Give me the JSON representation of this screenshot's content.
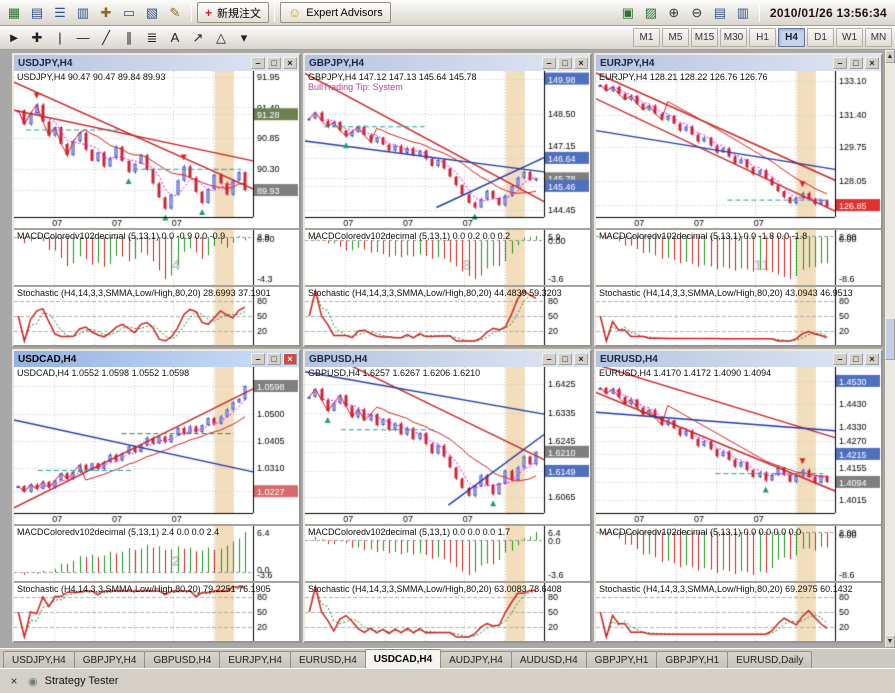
{
  "toolbar": {
    "main_icons": [
      {
        "name": "new-chart",
        "glyph": "▦",
        "color": "#2f6f2f"
      },
      {
        "name": "profiles",
        "glyph": "▤",
        "color": "#35508a"
      },
      {
        "name": "market-watch",
        "glyph": "☰",
        "color": "#35508a"
      },
      {
        "name": "data-window",
        "glyph": "▥",
        "color": "#35508a"
      },
      {
        "name": "navigator",
        "glyph": "✚",
        "color": "#8a6a20"
      },
      {
        "name": "terminal",
        "glyph": "▭",
        "color": "#35508a"
      },
      {
        "name": "strategy-tester-toolbar",
        "glyph": "▧",
        "color": "#35508a"
      },
      {
        "name": "metaeditor",
        "glyph": "✎",
        "color": "#8a6a20"
      }
    ],
    "new_order_glyph": "+",
    "new_order_label": "新規注文",
    "expert_glyph": "☺",
    "expert_advisors_label": "Expert Advisors",
    "window_icons": [
      {
        "name": "tile-windows",
        "glyph": "▣",
        "color": "#2f6f2f"
      },
      {
        "name": "cascade-windows",
        "glyph": "▨",
        "color": "#2f6f2f"
      },
      {
        "name": "zoom-in",
        "glyph": "⊕",
        "color": "#333333"
      },
      {
        "name": "zoom-out",
        "glyph": "⊖",
        "color": "#333333"
      },
      {
        "name": "tile-horizontally",
        "glyph": "▤",
        "color": "#35508a"
      },
      {
        "name": "tile-vertically",
        "glyph": "▥",
        "color": "#35508a"
      }
    ],
    "draw_icons": [
      {
        "name": "cursor",
        "glyph": "►",
        "color": "#222222"
      },
      {
        "name": "crosshair",
        "glyph": "✚",
        "color": "#222222"
      },
      {
        "name": "vertical-line",
        "glyph": "|",
        "color": "#222222"
      },
      {
        "name": "horizontal-line",
        "glyph": "—",
        "color": "#222222"
      },
      {
        "name": "trendline",
        "glyph": "╱",
        "color": "#222222"
      },
      {
        "name": "equidistant-channel",
        "glyph": "∥",
        "color": "#222222"
      },
      {
        "name": "fibonacci-retracement",
        "glyph": "≣",
        "color": "#222222"
      },
      {
        "name": "text",
        "glyph": "A",
        "color": "#222222"
      },
      {
        "name": "arrows",
        "glyph": "↗",
        "color": "#222222"
      },
      {
        "name": "shapes",
        "glyph": "△",
        "color": "#222222"
      },
      {
        "name": "indicators-dropdown",
        "glyph": "▾",
        "color": "#222222"
      }
    ],
    "datetime": "2010/01/26 13:56:34"
  },
  "timeframes": {
    "items": [
      "M1",
      "M5",
      "M15",
      "M30",
      "H1",
      "H4",
      "D1",
      "W1",
      "MN"
    ],
    "active": "H4"
  },
  "chrome": {
    "minimize": "–",
    "maximize": "□",
    "close": "×"
  },
  "colors": {
    "bull_fill": "#d8ddf6",
    "bull_edge": "#3c50c8",
    "bear": "#cc2233",
    "ma_fast": "#ff00ff",
    "ma_slow": "#d42222",
    "macd_up": "#1a9a1a",
    "macd_down": "#cc2222",
    "stoch_main": "#cc2222",
    "stoch_signal": "#2a8a2a",
    "band": "#f2ddbd",
    "grid": "#c9c9c9",
    "arrow_down": "#e02020",
    "arrow_up": "#1ea06a",
    "watermark": "#c6c6c6"
  },
  "windows": [
    {
      "title": "USDJPY,H4",
      "active": false,
      "ohlc": "USDJPY,H4  90.47 90.47 89.84 89.93",
      "annotation": "",
      "digits": 2,
      "price_min": 89.45,
      "price_max": 92.05,
      "ticks": [
        91.95,
        91.4,
        90.85,
        90.3
      ],
      "badges": [
        {
          "v": 91.28,
          "c": "#6e7f52"
        },
        {
          "v": 89.93,
          "c": "#7f7f7f"
        }
      ],
      "x_ticks": [
        "07",
        "07",
        "07"
      ],
      "band": [
        0.84,
        0.92
      ],
      "watermark": "4",
      "closes": [
        91.35,
        91.1,
        91.3,
        91.45,
        91.15,
        90.9,
        91.05,
        90.75,
        90.55,
        90.8,
        90.95,
        90.65,
        90.45,
        90.6,
        90.35,
        90.5,
        90.7,
        90.45,
        90.25,
        90.4,
        90.55,
        90.3,
        90.05,
        89.8,
        89.6,
        89.85,
        90.1,
        90.35,
        90.15,
        89.9,
        89.7,
        89.95,
        90.2,
        90.05,
        89.85,
        90.1,
        90.25,
        89.93
      ],
      "trend": [
        {
          "x1": 0,
          "p1": 91.85,
          "x2": 1,
          "p2": 89.95,
          "c": "#cc2222"
        },
        {
          "x1": 0,
          "p1": 91.35,
          "x2": 1,
          "p2": 90.45,
          "c": "#cc2222"
        },
        {
          "x1": 0.05,
          "p1": 91.0,
          "x2": 0.45,
          "p2": 91.0,
          "c": "#20a0a0",
          "d": 1
        },
        {
          "x1": 0.5,
          "p1": 90.3,
          "x2": 0.95,
          "p2": 90.3,
          "c": "#20a0a0",
          "d": 1
        }
      ],
      "macd_label": "MACDColoredv102decimal (5,13,1) 0.0 -0.9 0.0 -0.9",
      "macd_ticks": [
        "2.9",
        "0.00",
        "-4.3"
      ],
      "stoch_label": "Stochastic (H4,14,3,3,SMMA,Low/High,80,20) 28.6993 37.1901",
      "stoch_ticks": [
        "80",
        "50",
        "20"
      ]
    },
    {
      "title": "GBPJPY,H4",
      "active": false,
      "ohlc": "GBPJPY,H4  147.12 147.13 145.64 145.78",
      "annotation": "BullTrading Tip: System",
      "digits": 2,
      "price_min": 144.15,
      "price_max": 150.3,
      "ticks": [
        148.5,
        147.15,
        144.45
      ],
      "badges": [
        {
          "v": 149.98,
          "c": "#4f6fbf"
        },
        {
          "v": 146.64,
          "c": "#4f6fbf"
        },
        {
          "v": 145.78,
          "c": "#7f7f7f"
        },
        {
          "v": 145.46,
          "c": "#4f6fbf"
        }
      ],
      "x_ticks": [
        "07",
        "07",
        "07"
      ],
      "band": [
        0.84,
        0.92
      ],
      "watermark": "8",
      "closes": [
        148.3,
        148.55,
        148.2,
        147.95,
        148.15,
        147.8,
        147.55,
        147.75,
        147.95,
        147.6,
        147.3,
        147.5,
        147.2,
        146.95,
        147.15,
        146.85,
        147.05,
        146.75,
        146.95,
        146.6,
        146.3,
        146.55,
        146.2,
        145.85,
        145.5,
        145.1,
        144.75,
        144.55,
        144.9,
        145.25,
        144.95,
        144.65,
        145.05,
        145.45,
        145.8,
        146.05,
        145.7,
        145.78
      ],
      "trend": [
        {
          "x1": 0,
          "p1": 150.2,
          "x2": 1,
          "p2": 144.8,
          "c": "#cc2222"
        },
        {
          "x1": 0,
          "p1": 147.35,
          "x2": 1,
          "p2": 146.05,
          "c": "#2238a8"
        },
        {
          "x1": 0.55,
          "p1": 144.55,
          "x2": 1,
          "p2": 146.65,
          "c": "#2238a8"
        },
        {
          "x1": 0.08,
          "p1": 147.95,
          "x2": 0.5,
          "p2": 147.95,
          "c": "#20a0a0",
          "d": 1
        }
      ],
      "macd_label": "MACDColoredv102decimal (5,13,1) 0.0 0.2 0.0 0.2",
      "macd_ticks": [
        "5.9",
        "0.00",
        "-3.6"
      ],
      "stoch_label": "Stochastic (H4,14,3,3,SMMA,Low/High,80,20) 44.4839 59.3203",
      "stoch_ticks": [
        "80",
        "50",
        "20"
      ]
    },
    {
      "title": "EURJPY,H4",
      "active": false,
      "ohlc": "EURJPY,H4  128.21 128.22 126.76 126.76",
      "annotation": "",
      "digits": 2,
      "price_min": 126.25,
      "price_max": 133.6,
      "ticks": [
        133.1,
        131.4,
        129.75,
        128.05
      ],
      "badges": [
        {
          "v": 126.85,
          "c": "#e03030"
        }
      ],
      "x_ticks": [
        "07",
        "07",
        "07"
      ],
      "band": [
        0.84,
        0.92
      ],
      "watermark": "11",
      "closes": [
        132.9,
        132.6,
        132.8,
        132.45,
        132.15,
        132.35,
        131.95,
        131.65,
        131.85,
        131.45,
        131.15,
        131.35,
        130.95,
        130.6,
        130.8,
        130.4,
        130.05,
        130.25,
        129.85,
        129.5,
        129.7,
        129.3,
        128.95,
        129.15,
        128.75,
        128.4,
        128.6,
        128.2,
        127.85,
        127.55,
        127.25,
        126.95,
        127.2,
        127.45,
        127.15,
        126.9,
        127.1,
        126.76
      ],
      "trend": [
        {
          "x1": 0,
          "p1": 133.5,
          "x2": 1,
          "p2": 128.1,
          "c": "#cc2222"
        },
        {
          "x1": 0,
          "p1": 132.2,
          "x2": 1,
          "p2": 126.55,
          "c": "#cc2222"
        },
        {
          "x1": 0,
          "p1": 130.6,
          "x2": 1,
          "p2": 128.65,
          "c": "#2238a8"
        },
        {
          "x1": 0.55,
          "p1": 127.1,
          "x2": 0.97,
          "p2": 127.1,
          "c": "#20a0a0",
          "d": 1
        }
      ],
      "macd_label": "MACDColoredv102decimal (5,13,1) 0.0 -1.8 0.0 -1.8",
      "macd_ticks": [
        "2.00",
        "0.00",
        "-8.6"
      ],
      "stoch_label": "Stochastic (H4,14,3,3,SMMA,Low/High,80,20) 43.0943 46.9513",
      "stoch_ticks": [
        "80",
        "50",
        "20"
      ]
    },
    {
      "title": "USDCAD,H4",
      "active": true,
      "ohlc": "USDCAD,H4  1.0552 1.0598 1.0552 1.0598",
      "annotation": "",
      "digits": 4,
      "price_min": 1.015,
      "price_max": 1.0665,
      "ticks": [
        1.05,
        1.0405,
        1.031
      ],
      "badges": [
        {
          "v": 1.0598,
          "c": "#7f7f7f"
        },
        {
          "v": 1.0227,
          "c": "#d96a6a"
        }
      ],
      "x_ticks": [
        "07",
        "07",
        "07"
      ],
      "band": [
        0.84,
        0.92
      ],
      "watermark": "2",
      "closes": [
        1.0245,
        1.0225,
        1.025,
        1.0235,
        1.026,
        1.024,
        1.0265,
        1.029,
        1.027,
        1.0295,
        1.032,
        1.03,
        1.0325,
        1.0305,
        1.033,
        1.0355,
        1.0335,
        1.036,
        1.0385,
        1.0365,
        1.039,
        1.0415,
        1.0395,
        1.042,
        1.04,
        1.0425,
        1.045,
        1.043,
        1.0455,
        1.0435,
        1.046,
        1.0485,
        1.0465,
        1.049,
        1.0515,
        1.054,
        1.0552,
        1.0598
      ],
      "trend": [
        {
          "x1": 0,
          "p1": 1.0478,
          "x2": 1,
          "p2": 1.0295,
          "c": "#2238a8"
        },
        {
          "x1": 0,
          "p1": 1.0168,
          "x2": 1,
          "p2": 1.0588,
          "c": "#cc2222"
        },
        {
          "x1": 0.1,
          "p1": 1.03,
          "x2": 0.5,
          "p2": 1.03,
          "c": "#20a0a0",
          "d": 1
        },
        {
          "x1": 0.45,
          "p1": 1.043,
          "x2": 0.92,
          "p2": 1.043,
          "c": "#2a8a2a",
          "d": 1
        }
      ],
      "macd_label": "MACDColoredv102decimal (5,13,1) 2.4 0.0 0.0 2.4",
      "macd_ticks": [
        "6.4",
        "0.0",
        "-3.6"
      ],
      "stoch_label": "Stochastic (H4,14,3,3,SMMA,Low/High,80,20) 79.2251 76.1905",
      "stoch_ticks": [
        "80",
        "50",
        "20"
      ]
    },
    {
      "title": "GBPUSD,H4",
      "active": false,
      "ohlc": "GBPUSD,H4  1.6257 1.6267 1.6206 1.6210",
      "annotation": "",
      "digits": 4,
      "price_min": 1.6015,
      "price_max": 1.648,
      "ticks": [
        1.6425,
        1.6335,
        1.6245,
        1.6065
      ],
      "badges": [
        {
          "v": 1.621,
          "c": "#7f7f7f"
        },
        {
          "v": 1.6149,
          "c": "#4f6fbf"
        }
      ],
      "x_ticks": [
        "07",
        "07",
        "07"
      ],
      "band": [
        0.84,
        0.92
      ],
      "watermark": "",
      "closes": [
        1.6385,
        1.641,
        1.6375,
        1.634,
        1.6365,
        1.639,
        1.6355,
        1.632,
        1.6345,
        1.631,
        1.633,
        1.6295,
        1.6315,
        1.628,
        1.63,
        1.6265,
        1.6285,
        1.625,
        1.627,
        1.6235,
        1.6205,
        1.623,
        1.6195,
        1.616,
        1.6125,
        1.6095,
        1.607,
        1.61,
        1.6135,
        1.6105,
        1.6075,
        1.611,
        1.615,
        1.612,
        1.616,
        1.6195,
        1.617,
        1.621
      ],
      "trend": [
        {
          "x1": 0,
          "p1": 1.6555,
          "x2": 1,
          "p2": 1.6185,
          "c": "#cc2222"
        },
        {
          "x1": 0,
          "p1": 1.6465,
          "x2": 1,
          "p2": 1.633,
          "c": "#2238a8"
        },
        {
          "x1": 0.6,
          "p1": 1.604,
          "x2": 1,
          "p2": 1.6265,
          "c": "#2238a8"
        },
        {
          "x1": 0.15,
          "p1": 1.628,
          "x2": 0.55,
          "p2": 1.628,
          "c": "#20a0a0",
          "d": 1
        }
      ],
      "macd_label": "MACDColoredv102decimal (5,13,1) 0.0 0.0 0.0 1.7",
      "macd_ticks": [
        "6.4",
        "0.0",
        "-3.6"
      ],
      "stoch_label": "Stochastic (H4,14,3,3,SMMA,Low/High,80,20) 63.0083 78.6408",
      "stoch_ticks": [
        "80",
        "50",
        "20"
      ]
    },
    {
      "title": "EURUSD,H4",
      "active": false,
      "ohlc": "EURUSD,H4  1.4170 1.4172 1.4090 1.4094",
      "annotation": "",
      "digits": 4,
      "price_min": 1.396,
      "price_max": 1.459,
      "ticks": [
        1.443,
        1.433,
        1.427,
        1.4155,
        1.4015
      ],
      "badges": [
        {
          "v": 1.453,
          "c": "#4f6fbf"
        },
        {
          "v": 1.4215,
          "c": "#4f6fbf"
        },
        {
          "v": 1.4094,
          "c": "#7f7f7f"
        }
      ],
      "x_ticks": [
        "07",
        "07",
        "07"
      ],
      "band": [
        0.84,
        0.92
      ],
      "watermark": "",
      "closes": [
        1.45,
        1.4475,
        1.4495,
        1.446,
        1.443,
        1.445,
        1.4415,
        1.4385,
        1.4405,
        1.437,
        1.434,
        1.436,
        1.4325,
        1.4295,
        1.4315,
        1.428,
        1.425,
        1.427,
        1.4235,
        1.4205,
        1.4225,
        1.419,
        1.416,
        1.418,
        1.4145,
        1.4115,
        1.4135,
        1.41,
        1.4125,
        1.4155,
        1.4125,
        1.4095,
        1.412,
        1.4145,
        1.4115,
        1.409,
        1.412,
        1.4094
      ],
      "trend": [
        {
          "x1": 0,
          "p1": 1.46,
          "x2": 1,
          "p2": 1.4285,
          "c": "#cc2222"
        },
        {
          "x1": 0,
          "p1": 1.448,
          "x2": 1,
          "p2": 1.4055,
          "c": "#cc2222"
        },
        {
          "x1": 0,
          "p1": 1.4395,
          "x2": 1,
          "p2": 1.4315,
          "c": "#2238a8"
        },
        {
          "x1": 0.5,
          "p1": 1.413,
          "x2": 0.95,
          "p2": 1.413,
          "c": "#20a0a0",
          "d": 1
        }
      ],
      "macd_label": "MACDColoredv102decimal (5,13,1) 0.0 0.0 0.0 0.0",
      "macd_ticks": [
        "2.00",
        "0.00",
        "-8.6"
      ],
      "stoch_label": "Stochastic (H4,14,3,3,SMMA,Low/High,80,20) 69.2975 60.1432",
      "stoch_ticks": [
        "80",
        "50",
        "20"
      ]
    }
  ],
  "tabs": {
    "items": [
      "USDJPY,H4",
      "GBPJPY,H4",
      "GBPUSD,H4",
      "EURJPY,H4",
      "EURUSD,H4",
      "USDCAD,H4",
      "AUDJPY,H4",
      "AUDUSD,H4",
      "GBPJPY,H1",
      "GBPJPY,H1",
      "EURUSD,Daily"
    ],
    "active_index": 5
  },
  "statusbar": {
    "close_glyph": "×",
    "bullet_glyph": "◉",
    "label": "Strategy Tester"
  }
}
